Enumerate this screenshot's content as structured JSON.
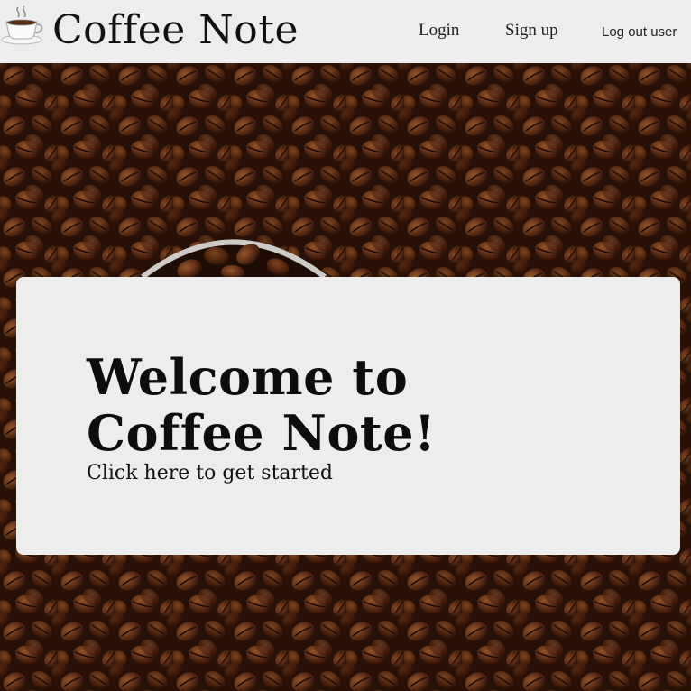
{
  "header": {
    "brand": "Coffee Note",
    "logo_icon": "coffee-cup-icon",
    "nav": {
      "login": "Login",
      "signup": "Sign up",
      "logout": "Log out user"
    }
  },
  "hero": {
    "background": "coffee-beans-photo",
    "title_line1": "Welcome to",
    "title_line2": "Coffee Note!",
    "cta": "Click here to get started"
  },
  "colors": {
    "header_bg": "#ededed",
    "card_bg": "#ededed",
    "text": "#111111",
    "bean_dark": "#3a1e0f",
    "bean_mid": "#6b3a1c",
    "bean_light": "#9a5a2c"
  }
}
